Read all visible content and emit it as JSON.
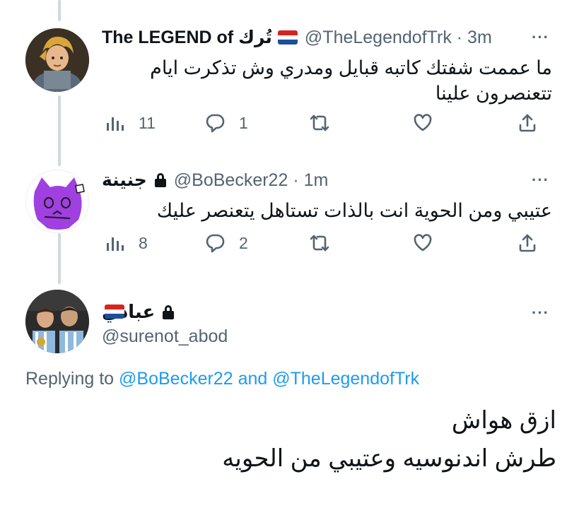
{
  "colors": {
    "accent": "#1d9bf0",
    "secondary_text": "#536471",
    "thread_line": "#cfd9de",
    "flag_red": "#d6241f",
    "flag_white": "#ffffff",
    "flag_blue": "#1e4e9a"
  },
  "tweets": [
    {
      "display_name": "The LEGEND of تُرك",
      "handle": "@TheLegendofTrk · 3m",
      "text_line1": "ما عممت شفتك كاتبه قبايل ومدري وش تذكرت ايام",
      "text_line2": "تتعنصرون علينا",
      "views": "11",
      "replies": "1",
      "more": "···",
      "has_flag": true,
      "icons": [
        "views-icon",
        "reply-icon",
        "retweet-icon",
        "like-icon",
        "share-icon"
      ]
    },
    {
      "display_name": "جنينة",
      "handle": "@BoBecker22 · 1m",
      "text_line1": "عتيبي ومن الحوية انت بالذات تستاهل يتعنصر عليك",
      "views": "8",
      "replies": "2",
      "more": "···",
      "protected": true,
      "icons": [
        "views-icon",
        "reply-icon",
        "retweet-icon",
        "like-icon",
        "share-icon"
      ]
    }
  ],
  "main_tweet": {
    "display_name": "عبادي",
    "handle": "@surenot_abod",
    "more": "···",
    "protected": true,
    "has_flag": true,
    "replying_prefix": "Replying to",
    "replying_user1": "@BoBecker22",
    "replying_and": "and",
    "replying_user2": "@TheLegendofTrk",
    "text_line1": "ازق هواش",
    "text_line2": "طرش اندنوسيه وعتيبي من الحويه"
  }
}
